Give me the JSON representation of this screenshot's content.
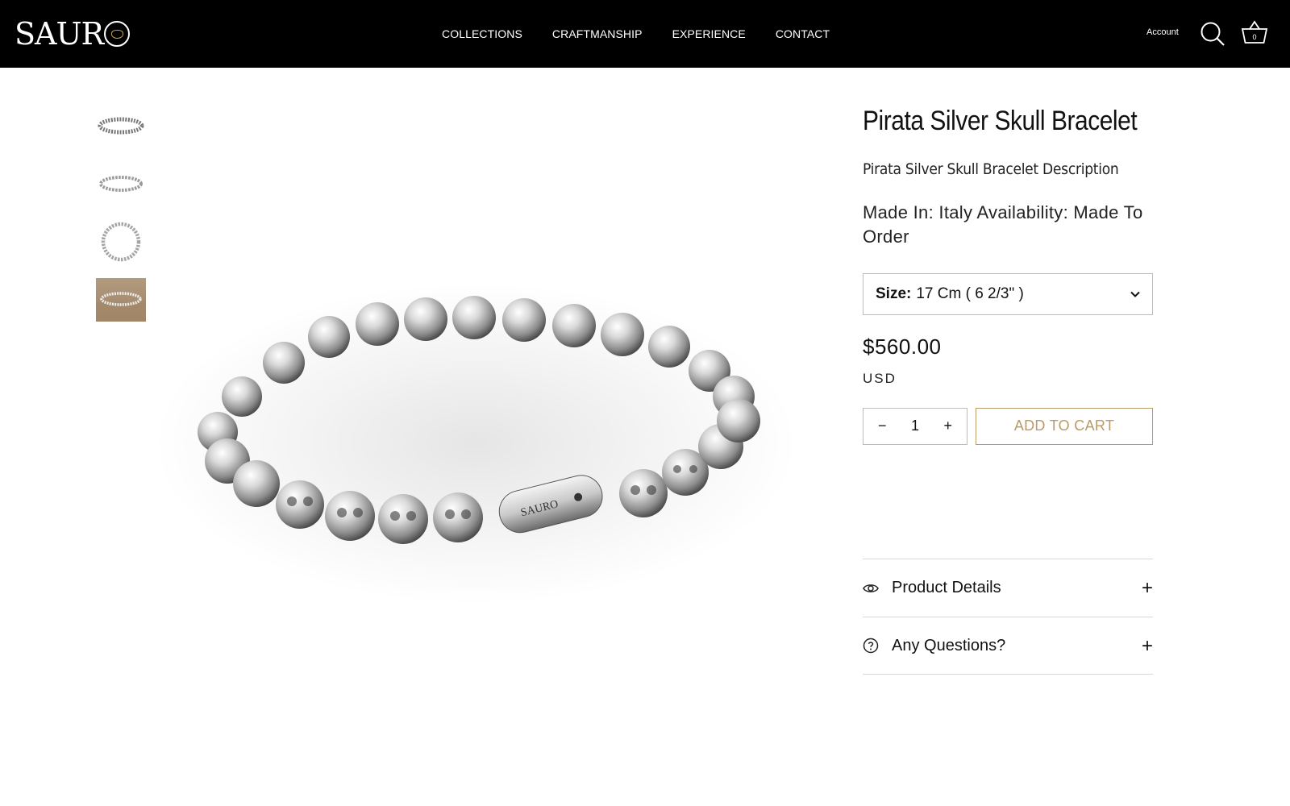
{
  "header": {
    "logo": "SAURO",
    "nav": [
      "COLLECTIONS",
      "CRAFTMANSHIP",
      "EXPERIENCE",
      "CONTACT"
    ],
    "account_label": "Account",
    "cart_count": "0"
  },
  "product": {
    "title": "Pirata Silver Skull Bracelet",
    "description": "Pirata Silver Skull Bracelet Description",
    "origin": "Made In: Italy Availability: Made To Order",
    "size_label": "Size:",
    "size_value": "17 Cm ( 6 2/3\" )",
    "price": "$560.00",
    "currency": "USD",
    "quantity": "1",
    "qty_minus": "−",
    "qty_plus": "+",
    "add_to_cart": "ADD TO CART",
    "clasp_engraving": "SAURO"
  },
  "accordion": [
    {
      "label": "Product Details",
      "icon": "eye-icon",
      "toggle": "+"
    },
    {
      "label": "Any Questions?",
      "icon": "question-circle-icon",
      "toggle": "+"
    }
  ],
  "thumbnails": [
    "thumbnail-side-view",
    "thumbnail-flat-view",
    "thumbnail-top-view",
    "thumbnail-lifestyle"
  ],
  "colors": {
    "header_bg": "#000000",
    "accent_gold": "#b99a68",
    "border": "#bcbcbc"
  }
}
